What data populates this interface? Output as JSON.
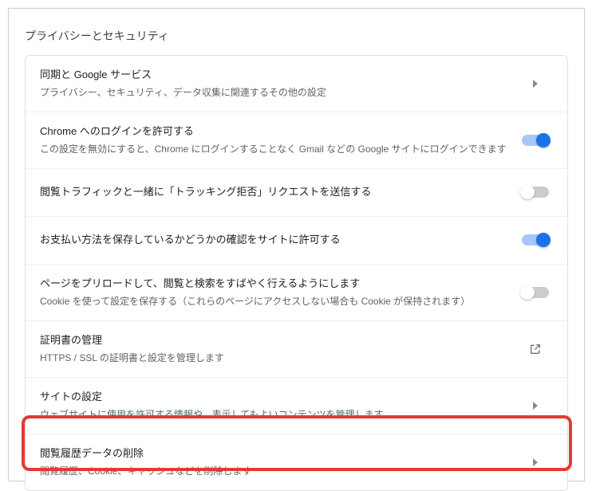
{
  "section_title": "プライバシーとセキュリティ",
  "rows": {
    "sync": {
      "title": "同期と Google サービス",
      "sub": "プライバシー、セキュリティ、データ収集に関連するその他の設定"
    },
    "login": {
      "title": "Chrome へのログインを許可する",
      "sub": "この設定を無効にすると、Chrome にログインすることなく Gmail などの Google サイトにログインできます"
    },
    "dnt": {
      "title": "閲覧トラフィックと一緒に「トラッキング拒否」リクエストを送信する"
    },
    "payment": {
      "title": "お支払い方法を保存しているかどうかの確認をサイトに許可する"
    },
    "preload": {
      "title": "ページをプリロードして、閲覧と検索をすばやく行えるようにします",
      "sub": "Cookie を使って設定を保存する（これらのページにアクセスしない場合も Cookie が保持されます）"
    },
    "cert": {
      "title": "証明書の管理",
      "sub": "HTTPS / SSL の証明書と設定を管理します"
    },
    "site": {
      "title": "サイトの設定",
      "sub": "ウェブサイトに使用を許可する情報や、表示してもよいコンテンツを管理します"
    },
    "clear": {
      "title": "閲覧履歴データの削除",
      "sub": "閲覧履歴、Cookie、キャッシュなどを削除します"
    }
  },
  "toggles": {
    "login": true,
    "dnt": false,
    "payment": true,
    "preload": false
  }
}
